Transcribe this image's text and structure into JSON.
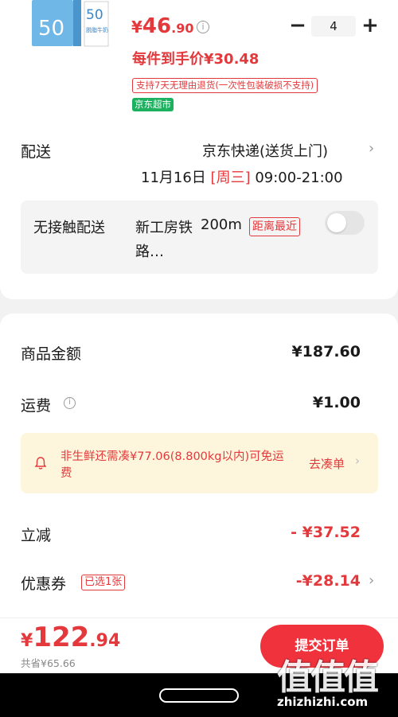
{
  "product": {
    "image_badge": "50",
    "image_label": "脱脂牛奶",
    "price_symbol": "¥",
    "price_int": "46",
    "price_dec": ".90",
    "quantity": "4",
    "unit_price_text": "每件到手价¥30.48",
    "return_policy": "支持7天无理由退货(一次性包装破损不支持)",
    "store_tag": "京东超市"
  },
  "delivery": {
    "label": "配送",
    "method": "京东快递(送货上门)",
    "date": "11月16日",
    "weekday": "[周三]",
    "time": "09:00-21:00",
    "contactless_label": "无接触配送",
    "address": "新工房铁路…",
    "distance": "200m",
    "nearest_tag": "距离最近"
  },
  "summary": {
    "goods_label": "商品金额",
    "goods_value": "¥187.60",
    "freight_label": "运费",
    "freight_value": "¥1.00",
    "notice_text": "非生鲜还需凑¥77.06(8.800kg以内)可免运费",
    "notice_link": "去凑单",
    "discount_label": "立减",
    "discount_value": "- ¥37.52",
    "coupon_label": "优惠券",
    "coupon_tag": "已选1张",
    "coupon_value": "-¥28.14"
  },
  "footer": {
    "total_symbol": "¥",
    "total_int": "122",
    "total_dec": ".94",
    "saved_text": "共省¥65.66",
    "submit_label": "提交订单"
  },
  "watermark": {
    "chars": "值值值",
    "url": "zhizhizhi.com"
  },
  "colors": {
    "accent": "#e4393c",
    "store_green": "#1bb15e",
    "notice_bg": "#fdf6dc"
  }
}
